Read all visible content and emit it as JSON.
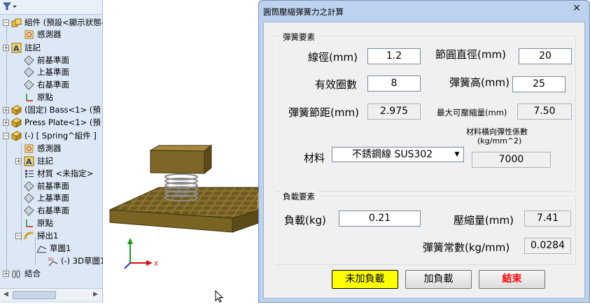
{
  "tree": {
    "rows": [
      {
        "label": "組件 (預設<顯示狀態-",
        "icon": "assembly-icon",
        "expander": "−"
      },
      {
        "label": "感測器",
        "icon": "sensor-icon",
        "expander": ""
      },
      {
        "label": "註記",
        "icon": "annotation-icon",
        "expander": "+"
      },
      {
        "label": "前基準面",
        "icon": "plane-icon",
        "expander": ""
      },
      {
        "label": "上基準面",
        "icon": "plane-icon",
        "expander": ""
      },
      {
        "label": "右基準面",
        "icon": "plane-icon",
        "expander": ""
      },
      {
        "label": "原點",
        "icon": "origin-icon",
        "expander": ""
      },
      {
        "label": "(固定) Bass<1> (預",
        "icon": "part-icon",
        "expander": "+"
      },
      {
        "label": "Press Plate<1> (預",
        "icon": "part-icon",
        "expander": "+"
      },
      {
        "label": "(-) [ Spring^組件 ]",
        "icon": "part-icon",
        "expander": "−"
      },
      {
        "label": "感測器",
        "icon": "sensor-icon",
        "expander": ""
      },
      {
        "label": "註記",
        "icon": "annotation-icon",
        "expander": "+"
      },
      {
        "label": "材質 <未指定>",
        "icon": "material-icon",
        "expander": ""
      },
      {
        "label": "前基準面",
        "icon": "plane-icon",
        "expander": ""
      },
      {
        "label": "上基準面",
        "icon": "plane-icon",
        "expander": ""
      },
      {
        "label": "右基準面",
        "icon": "plane-icon",
        "expander": ""
      },
      {
        "label": "原點",
        "icon": "origin-icon",
        "expander": ""
      },
      {
        "label": "掃出1",
        "icon": "sweep-icon",
        "expander": "−"
      },
      {
        "label": "草圖1",
        "icon": "sketch-icon",
        "expander": ""
      },
      {
        "label": "(-) 3D草圖1",
        "icon": "sketch3d-icon",
        "expander": ""
      },
      {
        "label": "結合",
        "icon": "mates-icon",
        "expander": "+"
      }
    ]
  },
  "viewport": {
    "axis_x": "X"
  },
  "dialog": {
    "title": "圓筒壓縮彈簧力之計算",
    "close": "✕",
    "spring_group": {
      "title": "彈簧要素",
      "wire_dia_label": "線徑(mm)",
      "wire_dia_value": "1.2",
      "pitch_dia_label": "節圓直徑(mm)",
      "pitch_dia_value": "20",
      "coils_label": "有效圈數",
      "coils_value": "8",
      "height_label": "彈簧高(mm)",
      "height_value": "25",
      "pitch_label": "彈簧節距(mm)",
      "pitch_value": "2.975",
      "max_comp_label": "最大可壓縮量(mm)",
      "max_comp_value": "7.50",
      "modulus_label_1": "材料橫向彈性係數",
      "modulus_label_2": "(kg/mm^2)",
      "modulus_value": "7000",
      "material_label": "材料",
      "material_value": "不銹鋼線 SUS302"
    },
    "load_group": {
      "title": "負載要素",
      "load_label": "負載(kg)",
      "load_value": "0.21",
      "compression_label": "壓縮量(mm)",
      "compression_value": "7.41",
      "rate_label": "彈簧常數(kg/mm)",
      "rate_value": "0.0284"
    },
    "buttons": {
      "no_load": "未加負載",
      "add_load": "加負載",
      "exit": "結束"
    }
  },
  "colors": {
    "no_load_button": "#ffff00",
    "exit_text": "#ff0000",
    "tree_background": "#dce8f6",
    "dialog_frame": "#bcd2ee"
  }
}
